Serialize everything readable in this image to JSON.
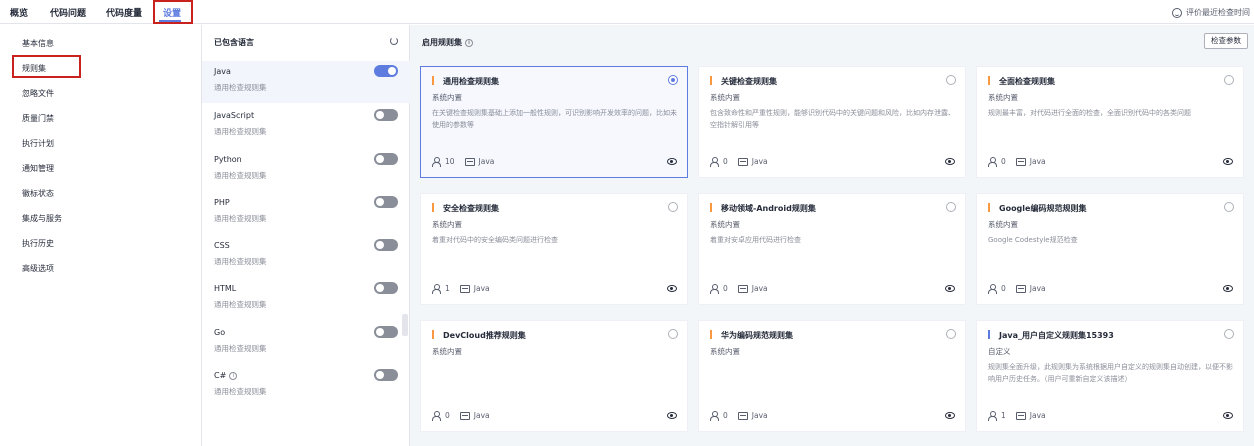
{
  "nav": {
    "tabs": [
      {
        "label": "概览"
      },
      {
        "label": "代码问题"
      },
      {
        "label": "代码度量"
      },
      {
        "label": "设置",
        "active": true
      }
    ],
    "recent_check": "评价最近检查时间"
  },
  "sidebar": {
    "items": [
      {
        "label": "基本信息"
      },
      {
        "label": "规则集",
        "active": true
      },
      {
        "label": "忽略文件"
      },
      {
        "label": "质量门禁"
      },
      {
        "label": "执行计划"
      },
      {
        "label": "通知管理"
      },
      {
        "label": "徽标状态"
      },
      {
        "label": "集成与服务"
      },
      {
        "label": "执行历史"
      },
      {
        "label": "高级选项"
      }
    ]
  },
  "languages": {
    "header": "已包含语言",
    "items": [
      {
        "name": "Java",
        "sub": "通用检查规则集",
        "enabled": true,
        "selected": true
      },
      {
        "name": "JavaScript",
        "sub": "通用检查规则集",
        "enabled": false
      },
      {
        "name": "Python",
        "sub": "通用检查规则集",
        "enabled": false
      },
      {
        "name": "PHP",
        "sub": "通用检查规则集",
        "enabled": false
      },
      {
        "name": "CSS",
        "sub": "通用检查规则集",
        "enabled": false
      },
      {
        "name": "HTML",
        "sub": "通用检查规则集",
        "enabled": false
      },
      {
        "name": "Go",
        "sub": "通用检查规则集",
        "enabled": false
      },
      {
        "name": "C#",
        "sub": "通用检查规则集",
        "enabled": false,
        "info": true
      }
    ]
  },
  "rulesets": {
    "title": "启用规则集",
    "param_button": "检查参数",
    "cards": [
      {
        "name": "通用检查规则集",
        "kind": "系统内置",
        "desc": "在关键检查规则集基础上添加一般性规则，可识别影响开发效率的问题，比如未使用的参数等",
        "count": "10",
        "lang": "Java",
        "selected": true,
        "accent": "#fa9841"
      },
      {
        "name": "关键检查规则集",
        "kind": "系统内置",
        "desc": "包含致命性和严重性规则，能够识别代码中的关键问题和风险，比如内存泄露、空指针解引用等",
        "count": "0",
        "lang": "Java",
        "accent": "#fa9841"
      },
      {
        "name": "全面检查规则集",
        "kind": "系统内置",
        "desc": "规则最丰富，对代码进行全面的检查，全面识别代码中的各类问题",
        "count": "0",
        "lang": "Java",
        "accent": "#fa9841"
      },
      {
        "name": "安全检查规则集",
        "kind": "系统内置",
        "desc": "着重对代码中的安全编码类问题进行检查",
        "count": "1",
        "lang": "Java",
        "accent": "#fa9841"
      },
      {
        "name": "移动领域-Android规则集",
        "kind": "系统内置",
        "desc": "着重对安卓应用代码进行检查",
        "count": "0",
        "lang": "Java",
        "accent": "#fa9841"
      },
      {
        "name": "Google编码规范规则集",
        "kind": "系统内置",
        "desc": "Google Codestyle规范检查",
        "count": "0",
        "lang": "Java",
        "accent": "#fa9841"
      },
      {
        "name": "DevCloud推荐规则集",
        "kind": "系统内置",
        "desc": "",
        "count": "0",
        "lang": "Java",
        "accent": "#fa9841"
      },
      {
        "name": "华为编码规范规则集",
        "kind": "系统内置",
        "desc": "",
        "count": "0",
        "lang": "Java",
        "accent": "#fa9841"
      },
      {
        "name": "Java_用户自定义规则集15393",
        "kind": "自定义",
        "desc": "规则集全面升级，此规则集为系统根据用户自定义的规则集自动创建，以便不影响用户历史任务。（用户可重新自定义该描述）",
        "count": "1",
        "lang": "Java",
        "accent": "#5e7ce0"
      }
    ]
  },
  "colors": {
    "accent": "#5e7ce0",
    "highlight_box": "#c9211e",
    "system_bar": "#fa9841"
  }
}
